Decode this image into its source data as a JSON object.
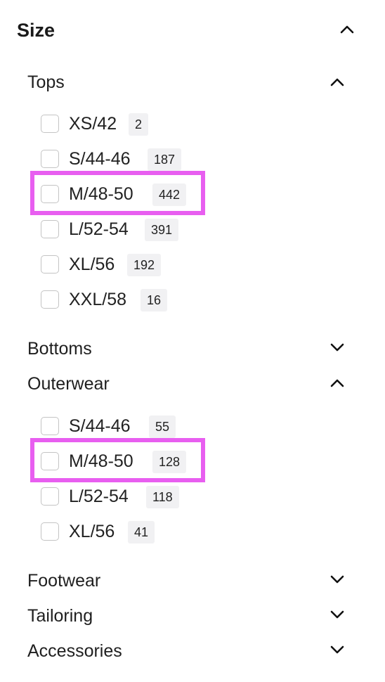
{
  "filter": {
    "title": "Size",
    "categories": [
      {
        "label": "Tops",
        "expanded": true,
        "options": [
          {
            "label": "XS/42",
            "count": "2",
            "checked": false
          },
          {
            "label": "S/44-46",
            "count": "187",
            "checked": false
          },
          {
            "label": "M/48-50",
            "count": "442",
            "checked": false,
            "highlighted": true
          },
          {
            "label": "L/52-54",
            "count": "391",
            "checked": false
          },
          {
            "label": "XL/56",
            "count": "192",
            "checked": false
          },
          {
            "label": "XXL/58",
            "count": "16",
            "checked": false
          }
        ]
      },
      {
        "label": "Bottoms",
        "expanded": false
      },
      {
        "label": "Outerwear",
        "expanded": true,
        "options": [
          {
            "label": "S/44-46",
            "count": "55",
            "checked": false
          },
          {
            "label": "M/48-50",
            "count": "128",
            "checked": false,
            "highlighted": true
          },
          {
            "label": "L/52-54",
            "count": "118",
            "checked": false
          },
          {
            "label": "XL/56",
            "count": "41",
            "checked": false
          }
        ]
      },
      {
        "label": "Footwear",
        "expanded": false
      },
      {
        "label": "Tailoring",
        "expanded": false
      },
      {
        "label": "Accessories",
        "expanded": false
      }
    ]
  },
  "colors": {
    "highlight": "#e85ef0",
    "badge_bg": "#f1f1f3",
    "checkbox_border": "#c4c4c4"
  },
  "icons": {
    "expanded": "chevron-up-icon",
    "collapsed": "chevron-down-icon"
  }
}
